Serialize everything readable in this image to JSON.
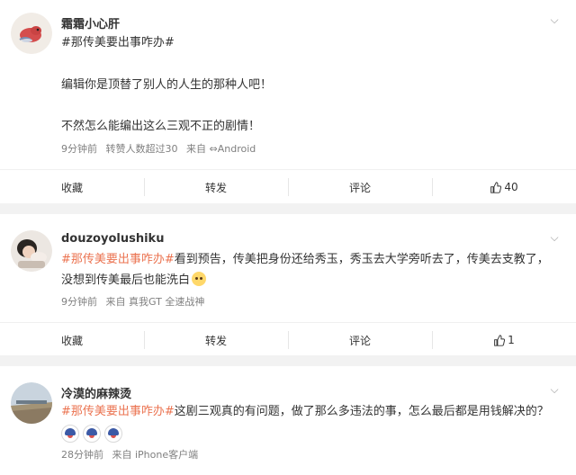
{
  "posts": [
    {
      "username": "霜霜小心肝",
      "topic_line": "#那传美要出事咋办#",
      "lines": [
        "编辑你是顶替了别人的人生的那种人吧！",
        "不然怎么能编出这么三观不正的剧情！"
      ],
      "meta": {
        "time": "9分钟前",
        "reposts": "转赞人数超过30",
        "source": "来自 ⇔Android"
      },
      "actions": {
        "favorite": "收藏",
        "repost": "转发",
        "comment": "评论",
        "like_count": "40"
      }
    },
    {
      "username": "douzoyolushiku",
      "topic": "#那传美要出事咋办#",
      "line1_rest": "看到预告，传美把身份还给秀玉，秀玉去大学旁听去了，传美去支教了，",
      "line2": "没想到传美最后也能洗白",
      "meta": {
        "time": "9分钟前",
        "source": "来自 真我GT 全速战神"
      },
      "actions": {
        "favorite": "收藏",
        "repost": "转发",
        "comment": "评论",
        "like_count": "1"
      }
    },
    {
      "username": "冷漠的麻辣烫",
      "topic": "#那传美要出事咋办#",
      "line1_rest": "这剧三观真的有问题，做了那么多违法的事，怎么最后都是用钱解决的？",
      "meta": {
        "time": "28分钟前",
        "source": "来自 iPhone客户端"
      }
    }
  ],
  "icons": {
    "chevron": "chevron-down-icon",
    "like": "thumbs-up-icon",
    "emoji": "smile-emoji-icon"
  },
  "colors": {
    "topic": "#eb7350",
    "meta": "#808080",
    "background": "#f2f2f2"
  }
}
